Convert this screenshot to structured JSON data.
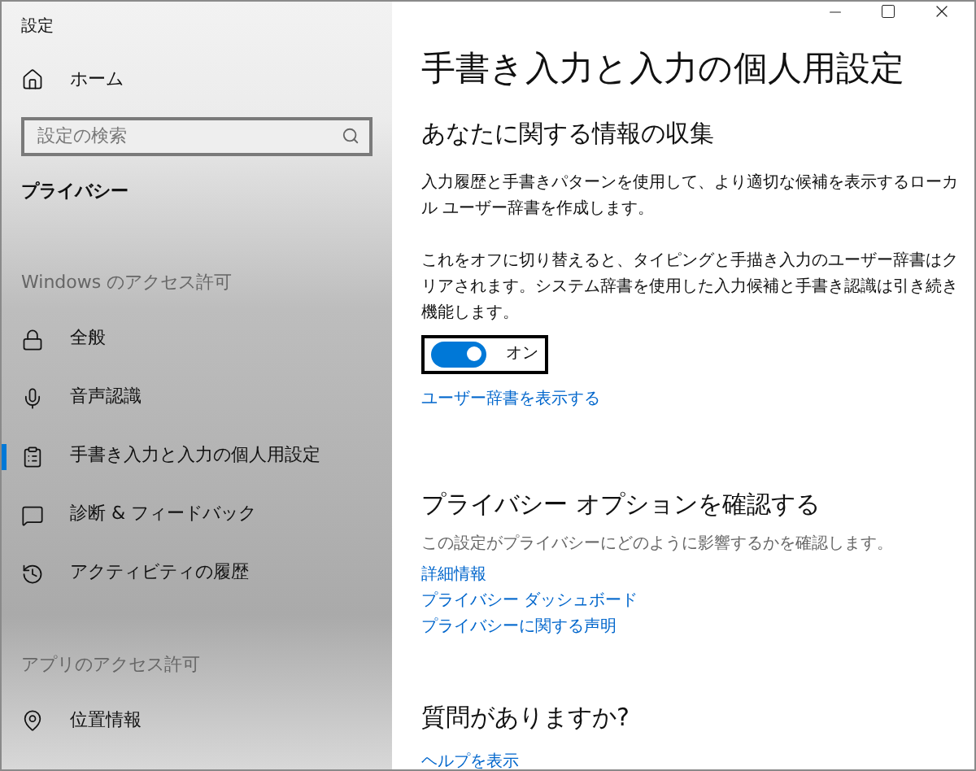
{
  "window": {
    "title": "設定"
  },
  "sidebar": {
    "home": "ホーム",
    "search": {
      "placeholder": "設定の検索"
    },
    "category": "プライバシー",
    "groups": [
      {
        "heading": "Windows のアクセス許可",
        "items": [
          {
            "label": "全般",
            "kind": "lock",
            "selected": false
          },
          {
            "label": "音声認識",
            "kind": "speech",
            "selected": false
          },
          {
            "label": "手書き入力と入力の個人用設定",
            "kind": "clipboard",
            "selected": true
          },
          {
            "label": "診断 & フィードバック",
            "kind": "feedback",
            "selected": false
          },
          {
            "label": "アクティビティの履歴",
            "kind": "timeline",
            "selected": false
          }
        ]
      },
      {
        "heading": "アプリのアクセス許可",
        "items": [
          {
            "label": "位置情報",
            "kind": "location",
            "selected": false
          }
        ]
      }
    ]
  },
  "page": {
    "title": "手書き入力と入力の個人用設定",
    "section": {
      "heading": "あなたに関する情報の収集",
      "paragraphs": [
        "入力履歴と手書きパターンを使用して、より適切な候補を表示するローカル ユーザー辞書を作成します。",
        "これをオフに切り替えると、タイピングと手描き入力のユーザー辞書はクリアされます。システム辞書を使用した入力候補と手書き認識は引き続き機能します。"
      ],
      "toggle": {
        "on": true,
        "label": "オン"
      },
      "link": "ユーザー辞書を表示する"
    },
    "privacy": {
      "heading": "プライバシー オプションを確認する",
      "description": "この設定がプライバシーにどのように影響するかを確認します。",
      "links": [
        "詳細情報",
        "プライバシー ダッシュボード",
        "プライバシーに関する声明"
      ]
    },
    "help": {
      "heading": "質問がありますか?",
      "link": "ヘルプを表示"
    }
  }
}
